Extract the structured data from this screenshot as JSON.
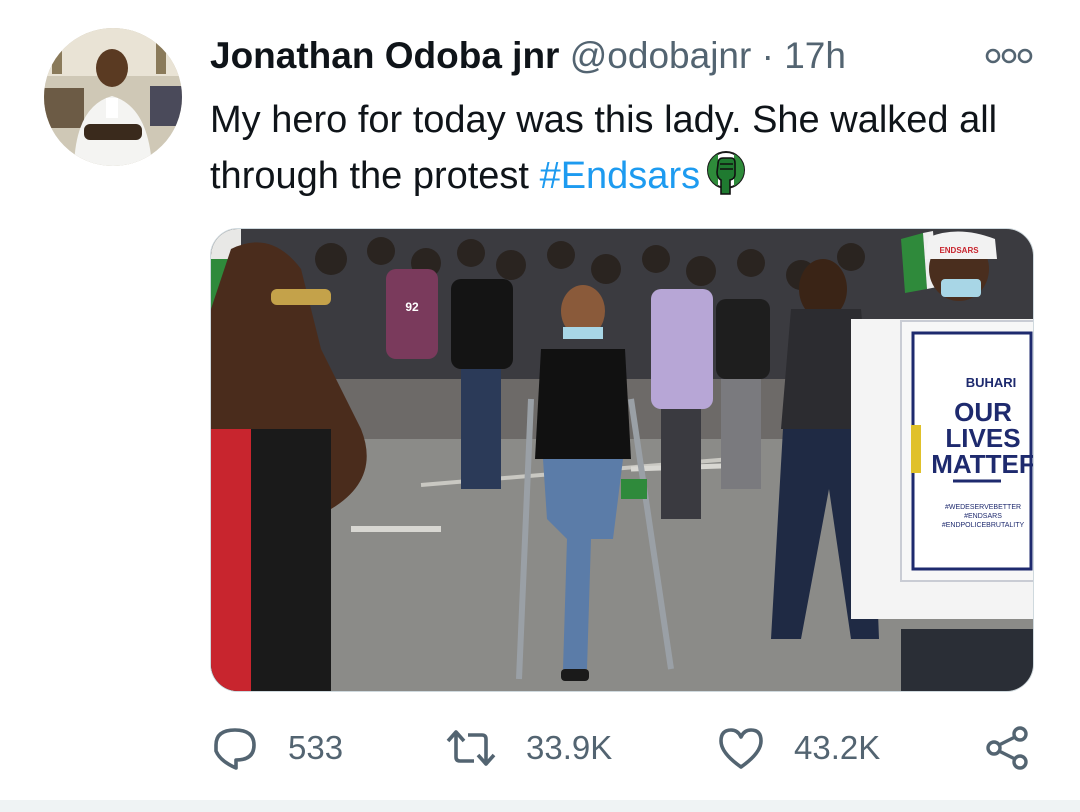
{
  "tweet": {
    "display_name": "Jonathan Odoba jnr",
    "handle": "@odobajnr",
    "separator": "·",
    "time": "17h",
    "text_before": "My hero for today was this lady. She walked all through the protest ",
    "hashtag": "#Endsars",
    "emoji_icon": "raised-fist-nigeria-flag-icon"
  },
  "media": {
    "placard_top": "BUHARI",
    "placard_line1": "OUR",
    "placard_line2": "LIVES",
    "placard_line3": "MATTEF",
    "placard_tags": [
      "#WEDESERVEBETTER",
      "#ENDSARS",
      "#ENDPOLICEBRUTALITY"
    ],
    "cap_text": "ENDSARS",
    "shirt_number": "92"
  },
  "actions": {
    "reply_count": "533",
    "retweet_count": "33.9K",
    "like_count": "43.2K"
  },
  "colors": {
    "text_primary": "#0f1419",
    "text_secondary": "#536471",
    "link": "#1d9bf0",
    "border": "#cfd9de"
  }
}
